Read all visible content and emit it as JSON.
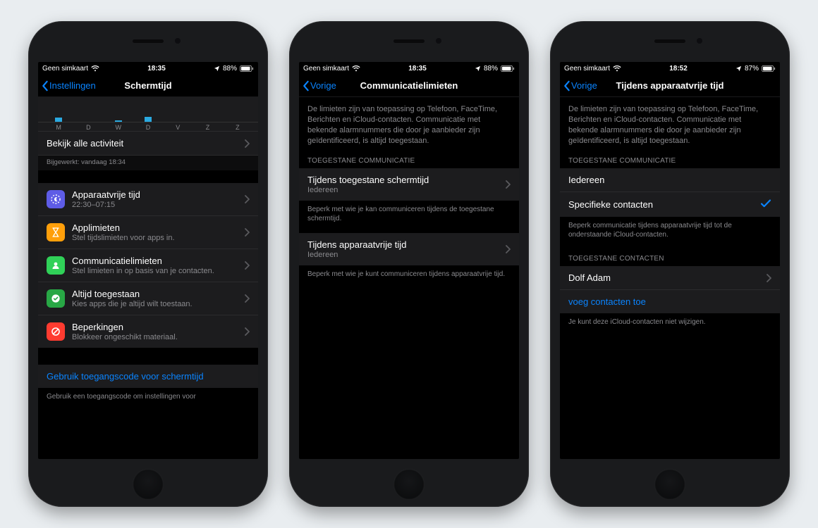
{
  "colors": {
    "accent": "#0a84ff",
    "iconPurple": "#5e5ce6",
    "iconOrange": "#ff9f0a",
    "iconGreen": "#30d158",
    "iconGreenDark": "#28a745",
    "iconRed": "#ff3b30"
  },
  "phones": [
    {
      "status": {
        "carrier": "Geen simkaart",
        "time": "18:35",
        "battery": "88%"
      },
      "nav": {
        "back": "Instellingen",
        "title": "Schermtijd"
      },
      "chartDays": [
        "M",
        "D",
        "W",
        "D",
        "V",
        "Z",
        "Z"
      ],
      "activityRow": "Bekijk alle activiteit",
      "updated": "Bijgewerkt: vandaag 18:34",
      "items": [
        {
          "icon": "moon",
          "iconColor": "iconPurple",
          "title": "Apparaatvrije tijd",
          "sub": "22:30–07:15"
        },
        {
          "icon": "hourglass",
          "iconColor": "iconOrange",
          "title": "Applimieten",
          "sub": "Stel tijdslimieten voor apps in."
        },
        {
          "icon": "person",
          "iconColor": "iconGreen",
          "title": "Communicatielimieten",
          "sub": "Stel limieten in op basis van je contacten."
        },
        {
          "icon": "check",
          "iconColor": "iconGreenDark",
          "title": "Altijd toegestaan",
          "sub": "Kies apps die je altijd wilt toestaan."
        },
        {
          "icon": "block",
          "iconColor": "iconRed",
          "title": "Beperkingen",
          "sub": "Blokkeer ongeschikt materiaal."
        }
      ],
      "passcodeLink": "Gebruik toegangscode voor schermtijd",
      "passcodeFooter": "Gebruik een toegangscode om instellingen voor"
    },
    {
      "status": {
        "carrier": "Geen simkaart",
        "time": "18:35",
        "battery": "88%"
      },
      "nav": {
        "back": "Vorige",
        "title": "Communicatielimieten"
      },
      "intro": "De limieten zijn van toepassing op Telefoon, FaceTime, Berichten en iCloud-contacten. Communicatie met bekende alarmnummers die door je aanbieder zijn geïdentificeerd, is altijd toegestaan.",
      "sectionHeader": "TOEGESTANE COMMUNICATIE",
      "rows": [
        {
          "title": "Tijdens toegestane schermtijd",
          "sub": "Iedereen",
          "footer": "Beperk met wie je kan communiceren tijdens de toegestane schermtijd."
        },
        {
          "title": "Tijdens apparaatvrije tijd",
          "sub": "Iedereen",
          "footer": "Beperk met wie je kunt communiceren tijdens apparaatvrije tijd."
        }
      ]
    },
    {
      "status": {
        "carrier": "Geen simkaart",
        "time": "18:52",
        "battery": "87%"
      },
      "nav": {
        "back": "Vorige",
        "title": "Tijdens apparaatvrije tijd"
      },
      "intro": "De limieten zijn van toepassing op Telefoon, FaceTime, Berichten en iCloud-contacten. Communicatie met bekende alarmnummers die door je aanbieder zijn geïdentificeerd, is altijd toegestaan.",
      "sectionHeader": "TOEGESTANE COMMUNICATIE",
      "optionEveryone": "Iedereen",
      "optionSpecific": "Specifieke contacten",
      "optionFooter": "Beperk communicatie tijdens apparaatvrije tijd tot de onderstaande iCloud-contacten.",
      "contactsHeader": "TOEGESTANE CONTACTEN",
      "contactName": "Dolf Adam",
      "addContacts": "voeg contacten toe",
      "contactsFooter": "Je kunt deze iCloud-contacten niet wijzigen."
    }
  ]
}
